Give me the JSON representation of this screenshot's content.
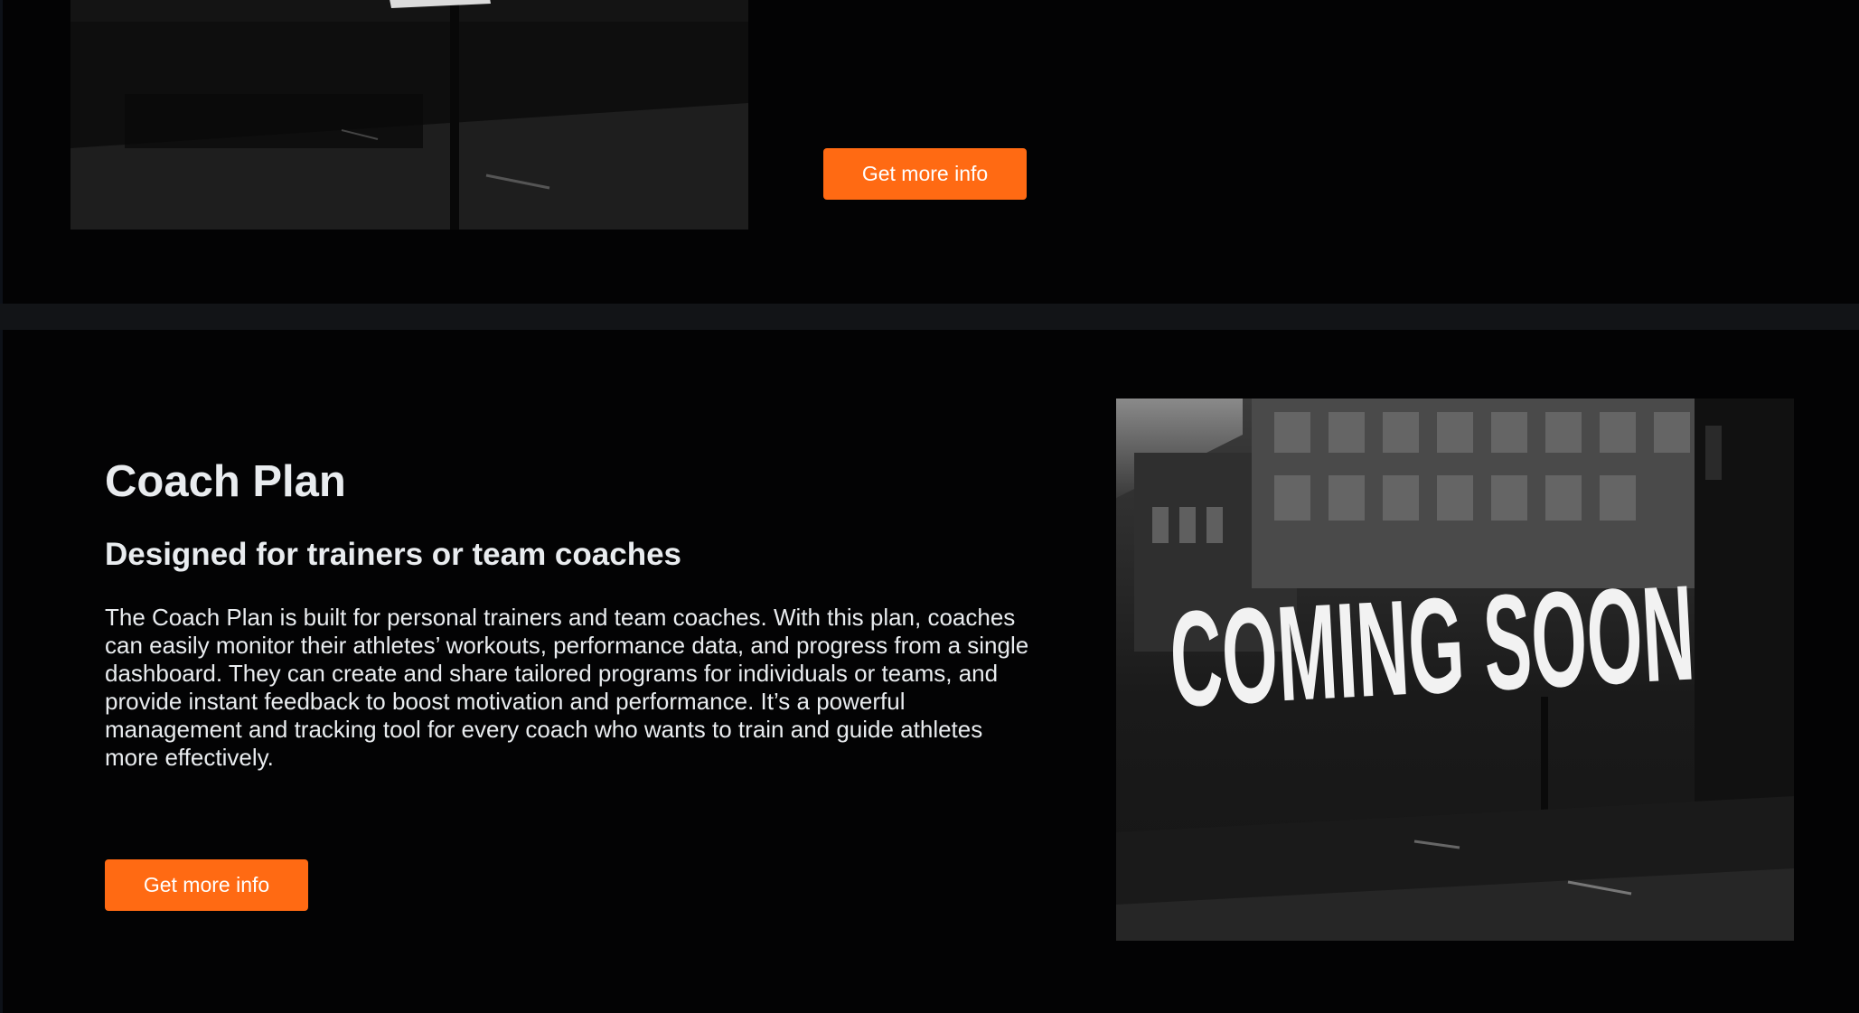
{
  "top_section": {
    "cta_label": "Get more info"
  },
  "coach_section": {
    "title": "Coach Plan",
    "subtitle": "Designed for trainers or team coaches",
    "description": "The Coach Plan is built for personal trainers and team coaches. With this plan, coaches can easily monitor their athletes’ workouts, performance data, and progress from a single dashboard. They can create and share tailored programs for individuals or teams, and provide instant feedback to boost motivation and performance. It’s a powerful management and tracking tool for every coach who wants to train and guide athletes more effectively.",
    "cta_label": "Get more info",
    "image_text": "COMING SOON"
  },
  "colors": {
    "background": "#030304",
    "accent": "#ff6a13",
    "divider": "#121417",
    "text": "#e9ecef"
  }
}
